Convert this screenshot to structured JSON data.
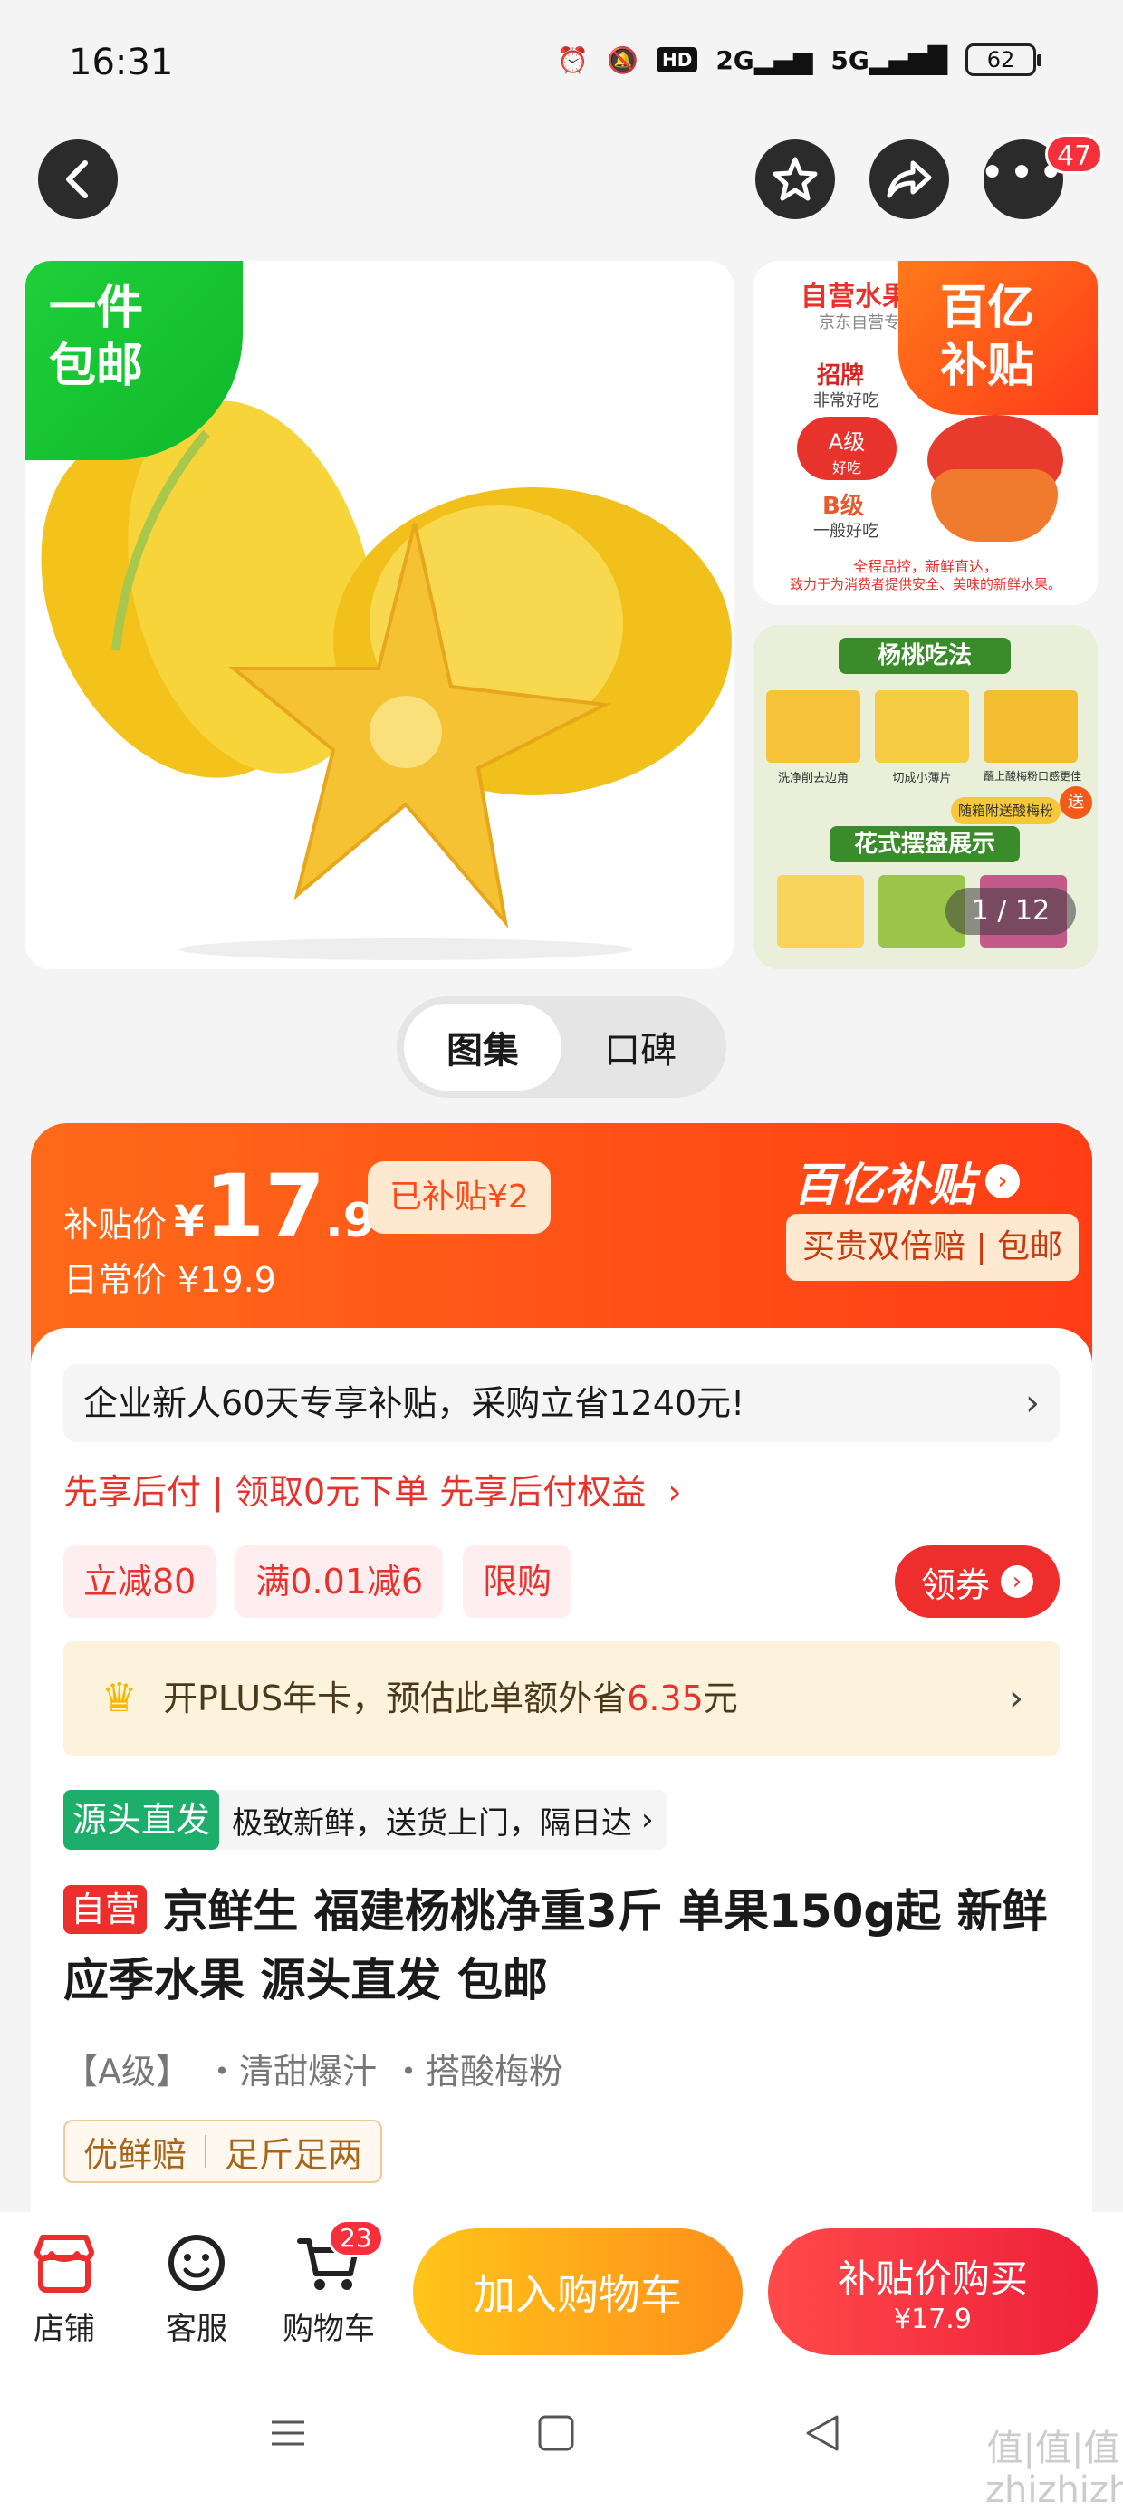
{
  "status_bar": {
    "time": "16:31",
    "network": "HD",
    "signal1": "2G",
    "signal2": "5G",
    "battery": "62"
  },
  "nav": {
    "menu_badge": "47"
  },
  "gallery": {
    "main_tag": "一件\n包邮",
    "side1": {
      "title": "自营水果品",
      "subtitle": "京东自营专业品",
      "sub_tag": "百亿\n补贴",
      "grade_top": "招牌",
      "grade_top_desc": "非常好吃",
      "grade_mid": "A级",
      "grade_mid_desc": "好吃",
      "grade_low": "B级",
      "grade_low_desc": "一般好吃",
      "footer1": "全程品控，新鲜直达，",
      "footer2": "致力于为消费者提供安全、美味的新鲜水果。"
    },
    "side2": {
      "title": "杨桃吃法",
      "step1": "洗净削去边角",
      "step2": "切成小薄片",
      "step3": "蘸上酸梅粉口感更佳",
      "gift": "随箱附送酸梅粉",
      "gift_mark": "送",
      "title2": "花式摆盘展示",
      "counter": "1 / 12"
    }
  },
  "tabs": [
    {
      "label": "图集"
    },
    {
      "label": "口碑"
    }
  ],
  "price": {
    "label": "补贴价",
    "currency": "¥",
    "integer": "17",
    "decimal": ".9",
    "subsidy_tag": "已补贴¥2",
    "daily_label": "日常价 ¥19.9",
    "brand": "百亿补贴",
    "guarantee": "买贵双倍赔 | 包邮"
  },
  "promo": {
    "enterprise": "企业新人60天专享补贴，采购立省1240元!",
    "pay_later": "先享后付 | 领取0元下单 先享后付权益",
    "coupons": [
      "立减80",
      "满0.01减6",
      "限购"
    ],
    "get_coupon": "领券",
    "plus_text": "开PLUS年卡，预估此单额外省",
    "plus_amount": "6.35",
    "plus_unit": "元"
  },
  "source": {
    "tag": "源头直发",
    "text": "极致新鲜，送货上门，隔日达"
  },
  "product": {
    "self_tag": "自营",
    "title": "京鲜生 福建杨桃净重3斤 单果150g起 新鲜应季水果 源头直发 包邮",
    "attrs": [
      "【A级】",
      "・清甜爆汁",
      "・搭酸梅粉"
    ],
    "service_tags": [
      "优鲜赔",
      "足斤足两"
    ]
  },
  "bottom_bar": {
    "shop": "店铺",
    "service": "客服",
    "cart": "购物车",
    "cart_badge": "23",
    "add_cart": "加入购物车",
    "buy_main": "补贴价购买",
    "buy_price": "¥17.9"
  },
  "watermark": "值|值|值\nzhizhizhi.com",
  "colors": {
    "accent": "#ff4a1a",
    "red": "#e8332d",
    "green": "#1fcf3a",
    "gold": "#ff8f1a"
  }
}
